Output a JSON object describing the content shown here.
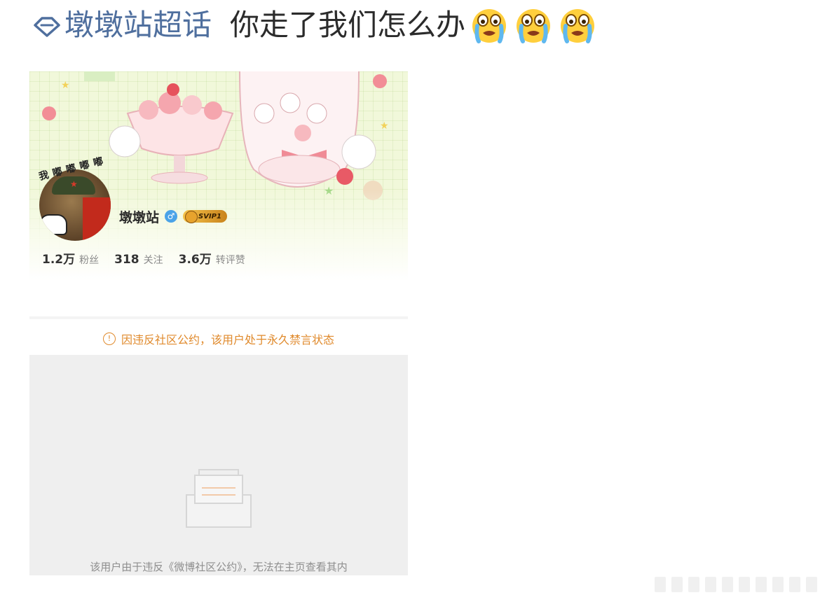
{
  "post": {
    "topic_label": "墩墩站超话",
    "text": "你走了我们怎么办",
    "emojis": [
      "crying-emoji",
      "crying-emoji",
      "crying-emoji"
    ]
  },
  "profile": {
    "nickname": "墩墩站",
    "avatar_caption": "我嘟嘟嘟嘟",
    "gender": "male",
    "vip_badge": "SVIP1",
    "stats": [
      {
        "value": "1.2万",
        "label": "粉丝"
      },
      {
        "value": "318",
        "label": "关注"
      },
      {
        "value": "3.6万",
        "label": "转评赞"
      }
    ]
  },
  "ban_notice": "因违反社区公约，该用户处于永久禁言状态",
  "empty_state": {
    "text": "该用户由于违反《微博社区公约》，无法在主页查看其内"
  },
  "colors": {
    "topic_link": "#4f6f9e",
    "notice_orange": "#e08a2c",
    "empty_bg": "#efefef"
  }
}
